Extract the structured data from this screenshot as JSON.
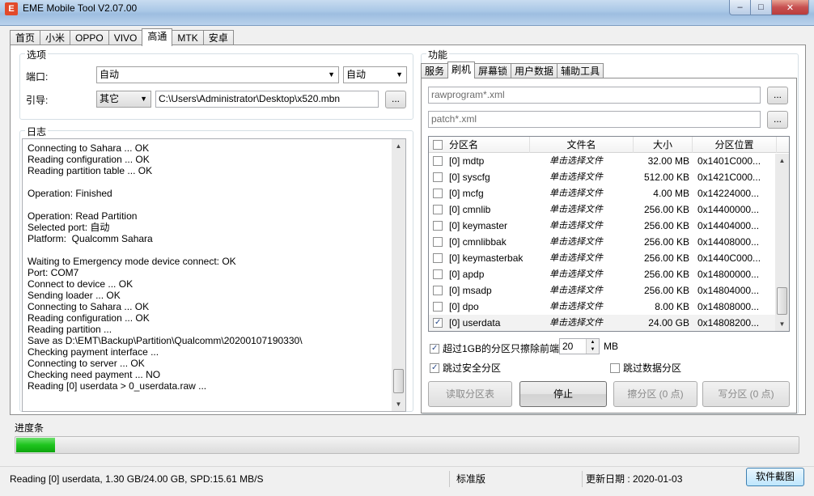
{
  "window": {
    "title": "EME Mobile Tool V2.07.00",
    "app_icon": "E"
  },
  "main_tabs": [
    {
      "label": "首页"
    },
    {
      "label": "小米"
    },
    {
      "label": "OPPO"
    },
    {
      "label": "VIVO"
    },
    {
      "label": "高通",
      "active": true
    },
    {
      "label": "MTK"
    },
    {
      "label": "安卓"
    }
  ],
  "options": {
    "title": "选项",
    "port_label": "端口:",
    "port_value": "自动",
    "port_mode": "自动",
    "boot_label": "引导:",
    "boot_value": "其它",
    "boot_path": "C:\\Users\\Administrator\\Desktop\\x520.mbn",
    "browse_label": "..."
  },
  "log": {
    "title": "日志",
    "lines": [
      "Connecting to Sahara ... OK",
      "Reading configuration ... OK",
      "Reading partition table ... OK",
      "",
      "Operation: Finished",
      "",
      "Operation: Read Partition",
      "Selected port: 自动",
      "Platform:  Qualcomm Sahara",
      "",
      "Waiting to Emergency mode device connect: OK",
      "Port: COM7",
      "Connect to device ... OK",
      "Sending loader ... OK",
      "Connecting to Sahara ... OK",
      "Reading configuration ... OK",
      "Reading partition ...",
      "Save as D:\\EMT\\Backup\\Partition\\Qualcomm\\20200107190330\\",
      "Checking payment interface ...",
      "Connecting to server ... OK",
      "Checking need payment ... NO",
      "Reading [0] userdata > 0_userdata.raw ..."
    ]
  },
  "function": {
    "title": "功能",
    "tabs": [
      {
        "label": "服务"
      },
      {
        "label": "刷机",
        "active": true
      },
      {
        "label": "屏幕锁"
      },
      {
        "label": "用户数据"
      },
      {
        "label": "辅助工具"
      }
    ],
    "rawprogram_placeholder": "rawprogram*.xml",
    "patch_placeholder": "patch*.xml",
    "browse_label": "...",
    "columns": [
      "分区名",
      "文件名",
      "大小",
      "分区位置"
    ],
    "rows": [
      {
        "name": "[0] mdtp",
        "file": "单击选择文件",
        "size": "32.00 MB",
        "loc": "0x1401C000..."
      },
      {
        "name": "[0] syscfg",
        "file": "单击选择文件",
        "size": "512.00 KB",
        "loc": "0x1421C000..."
      },
      {
        "name": "[0] mcfg",
        "file": "单击选择文件",
        "size": "4.00 MB",
        "loc": "0x14224000..."
      },
      {
        "name": "[0] cmnlib",
        "file": "单击选择文件",
        "size": "256.00 KB",
        "loc": "0x14400000..."
      },
      {
        "name": "[0] keymaster",
        "file": "单击选择文件",
        "size": "256.00 KB",
        "loc": "0x14404000..."
      },
      {
        "name": "[0] cmnlibbak",
        "file": "单击选择文件",
        "size": "256.00 KB",
        "loc": "0x14408000..."
      },
      {
        "name": "[0] keymasterbak",
        "file": "单击选择文件",
        "size": "256.00 KB",
        "loc": "0x1440C000..."
      },
      {
        "name": "[0] apdp",
        "file": "单击选择文件",
        "size": "256.00 KB",
        "loc": "0x14800000..."
      },
      {
        "name": "[0] msadp",
        "file": "单击选择文件",
        "size": "256.00 KB",
        "loc": "0x14804000..."
      },
      {
        "name": "[0] dpo",
        "file": "单击选择文件",
        "size": "8.00 KB",
        "loc": "0x14808000..."
      },
      {
        "name": "[0] userdata",
        "file": "单击选择文件",
        "size": "24.00 GB",
        "loc": "0x14808200...",
        "checked": true
      }
    ],
    "erase_option_label": "超过1GB的分区只擦除前端",
    "erase_value": "20",
    "erase_unit": "MB",
    "skip_secure_label": "跳过安全分区",
    "skip_data_label": "跳过数据分区",
    "buttons": {
      "read_table": "读取分区表",
      "stop": "停止",
      "erase": "擦分区 (0 点)",
      "write": "写分区 (0 点)"
    }
  },
  "progress": {
    "label": "进度条",
    "fraction": 0.05
  },
  "status": {
    "message": "Reading [0] userdata, 1.30 GB/24.00 GB, SPD:15.61 MB/S",
    "edition": "标准版",
    "update_date": "更新日期 : 2020-01-03",
    "screenshot_button": "软件截图"
  },
  "icons": {
    "minimize": "minimize-icon",
    "maximize": "maximize-icon",
    "close": "close-icon",
    "dropdown": "chevron-down-icon"
  }
}
